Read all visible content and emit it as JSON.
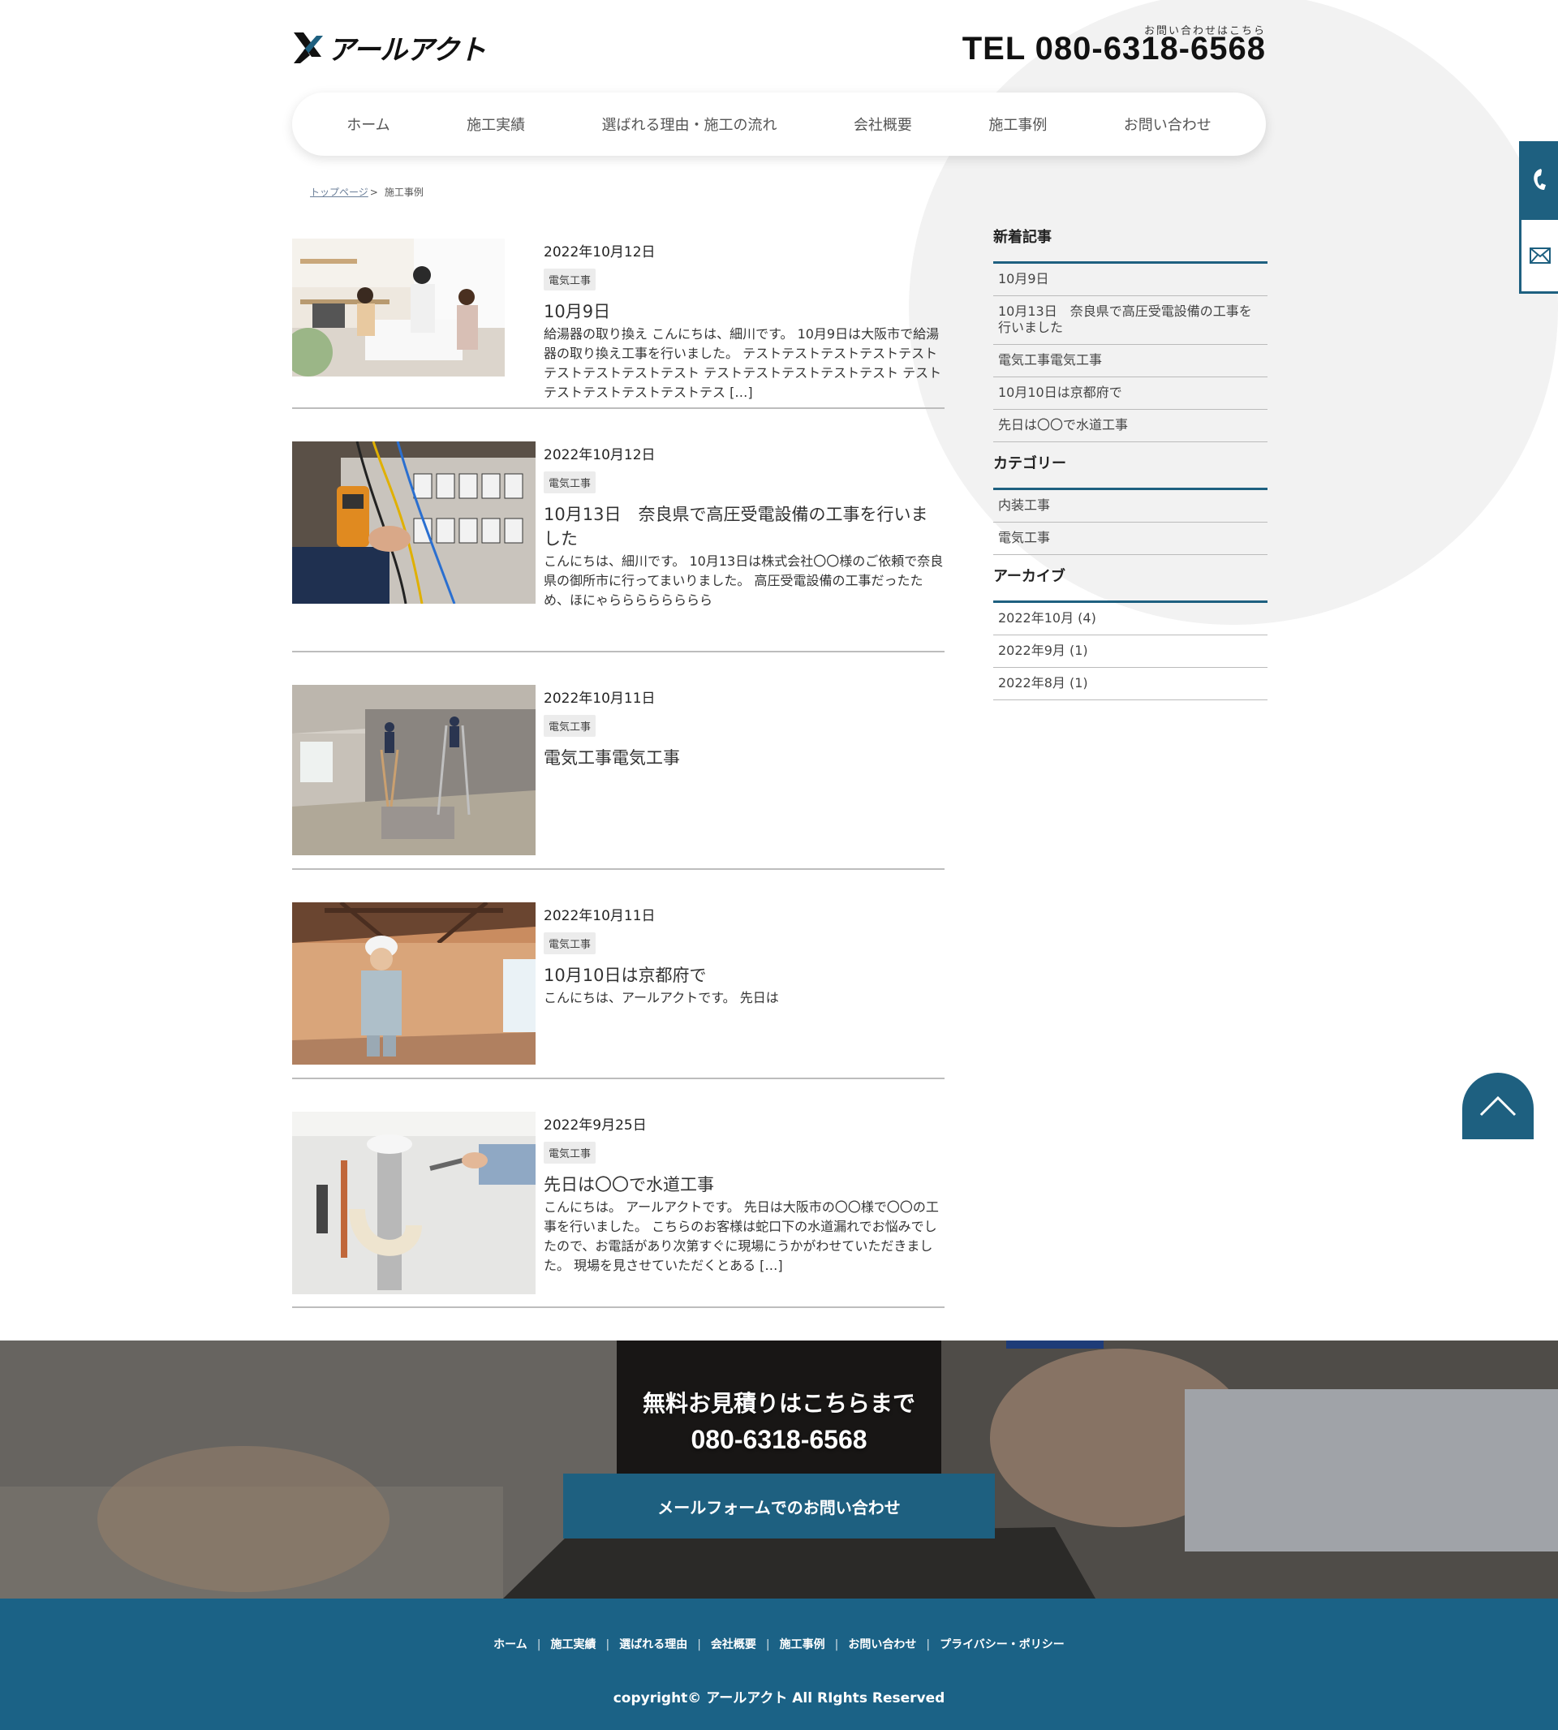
{
  "header": {
    "logo_text": "アールアクト",
    "tel_note": "お問い合わせはこちら",
    "tel": "TEL 080-6318-6568"
  },
  "nav": {
    "items": [
      "ホーム",
      "施工実績",
      "選ばれる理由・施工の流れ",
      "会社概要",
      "施工事例",
      "お問い合わせ"
    ]
  },
  "breadcrumb": {
    "home": "トップページ",
    "separator": ">",
    "current": "施工事例"
  },
  "posts": [
    {
      "date": "2022年10月12日",
      "category": "電気工事",
      "title": "10月9日",
      "excerpt": "給湯器の取り換え こんにちは、細川です。 10月9日は大阪市で給湯器の取り換え工事を行いました。 テストテストテストテストテストテストテストテストテスト テストテストテストテストテスト テストテストテストテストテストテス […]",
      "image": "kitchen-consultation-photo"
    },
    {
      "date": "2022年10月12日",
      "category": "電気工事",
      "title": "10月13日　奈良県で高圧受電設備の工事を行いました",
      "excerpt": "こんにちは、細川です。 10月13日は株式会社〇〇様のご依頼で奈良県の御所市に行ってまいりました。 高圧受電設備の工事だったため、ほにゃらららららららら",
      "image": "electrical-panel-photo"
    },
    {
      "date": "2022年10月11日",
      "category": "電気工事",
      "title": "電気工事電気工事",
      "excerpt": "",
      "image": "interior-renovation-photo"
    },
    {
      "date": "2022年10月11日",
      "category": "電気工事",
      "title": "10月10日は京都府で",
      "excerpt": "こんにちは、アールアクトです。 先日は",
      "image": "worker-helmet-photo"
    },
    {
      "date": "2022年9月25日",
      "category": "電気工事",
      "title": "先日は〇〇で水道工事",
      "excerpt": "こんにちは。 アールアクトです。 先日は大阪市の〇〇様で〇〇の工事を行いました。 こちらのお客様は蛇口下の水道漏れでお悩みでしたので、お電話があり次第すぐに現場にうかがわせていただきました。 現場を見させていただくとある […]",
      "image": "sink-plumbing-photo"
    }
  ],
  "sidebar": {
    "recent_title": "新着記事",
    "recent": [
      "10月9日",
      "10月13日　奈良県で高圧受電設備の工事を行いました",
      "電気工事電気工事",
      "10月10日は京都府で",
      "先日は〇〇で水道工事"
    ],
    "category_title": "カテゴリー",
    "categories": [
      "内装工事",
      "電気工事"
    ],
    "archive_title": "アーカイブ",
    "archives": [
      "2022年10月 (4)",
      "2022年9月 (1)",
      "2022年8月 (1)"
    ]
  },
  "cta": {
    "title": "無料お見積りはこちらまで",
    "tel": "080-6318-6568",
    "button": "メールフォームでのお問い合わせ"
  },
  "footer": {
    "nav": [
      "ホーム",
      "施工実績",
      "選ばれる理由",
      "会社概要",
      "施工事例",
      "お問い合わせ",
      "プライバシー・ポリシー"
    ],
    "separator": "|",
    "copyright": "copyright© アールアクト All RIghts Reserved"
  },
  "colors": {
    "accent": "#1e6080",
    "footer_bg": "#1b6286",
    "circle_bg": "#f2f2f2"
  },
  "icons": [
    "phone-icon",
    "mail-icon",
    "arrow-up-icon"
  ]
}
